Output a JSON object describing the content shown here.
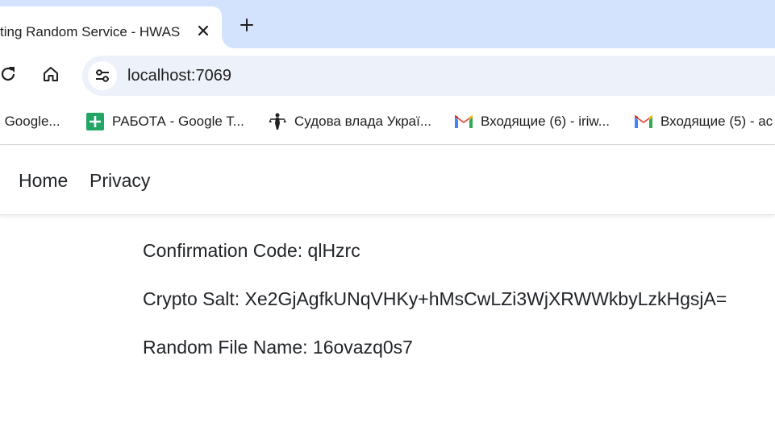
{
  "tab": {
    "title": "ting Random Service - HWAS",
    "active": true
  },
  "toolbar": {
    "url": "localhost:7069"
  },
  "bookmarks": [
    {
      "label": "ь Google...",
      "icon": "none"
    },
    {
      "label": "РАБОТА - Google T...",
      "icon": "google-sheets-icon"
    },
    {
      "label": "Судова влада Украї...",
      "icon": "justice-statue-icon"
    },
    {
      "label": "Входящие (6) - iriw...",
      "icon": "gmail-icon"
    },
    {
      "label": "Входящие (5) - ac",
      "icon": "gmail-icon"
    }
  ],
  "nav": {
    "home": "Home",
    "privacy": "Privacy"
  },
  "content": {
    "confirmation": "Confirmation Code: qlHzrc",
    "salt": "Crypto Salt: Xe2GjAgfkUNqVHKy+hMsCwLZi3WjXRWWkbyLzkHgsjA=",
    "filename": "Random File Name: 16ovazq0s7"
  },
  "colors": {
    "tabstrip": "#d3e3fd",
    "omnibox": "#edf2fa",
    "text": "#1f1f1f"
  }
}
